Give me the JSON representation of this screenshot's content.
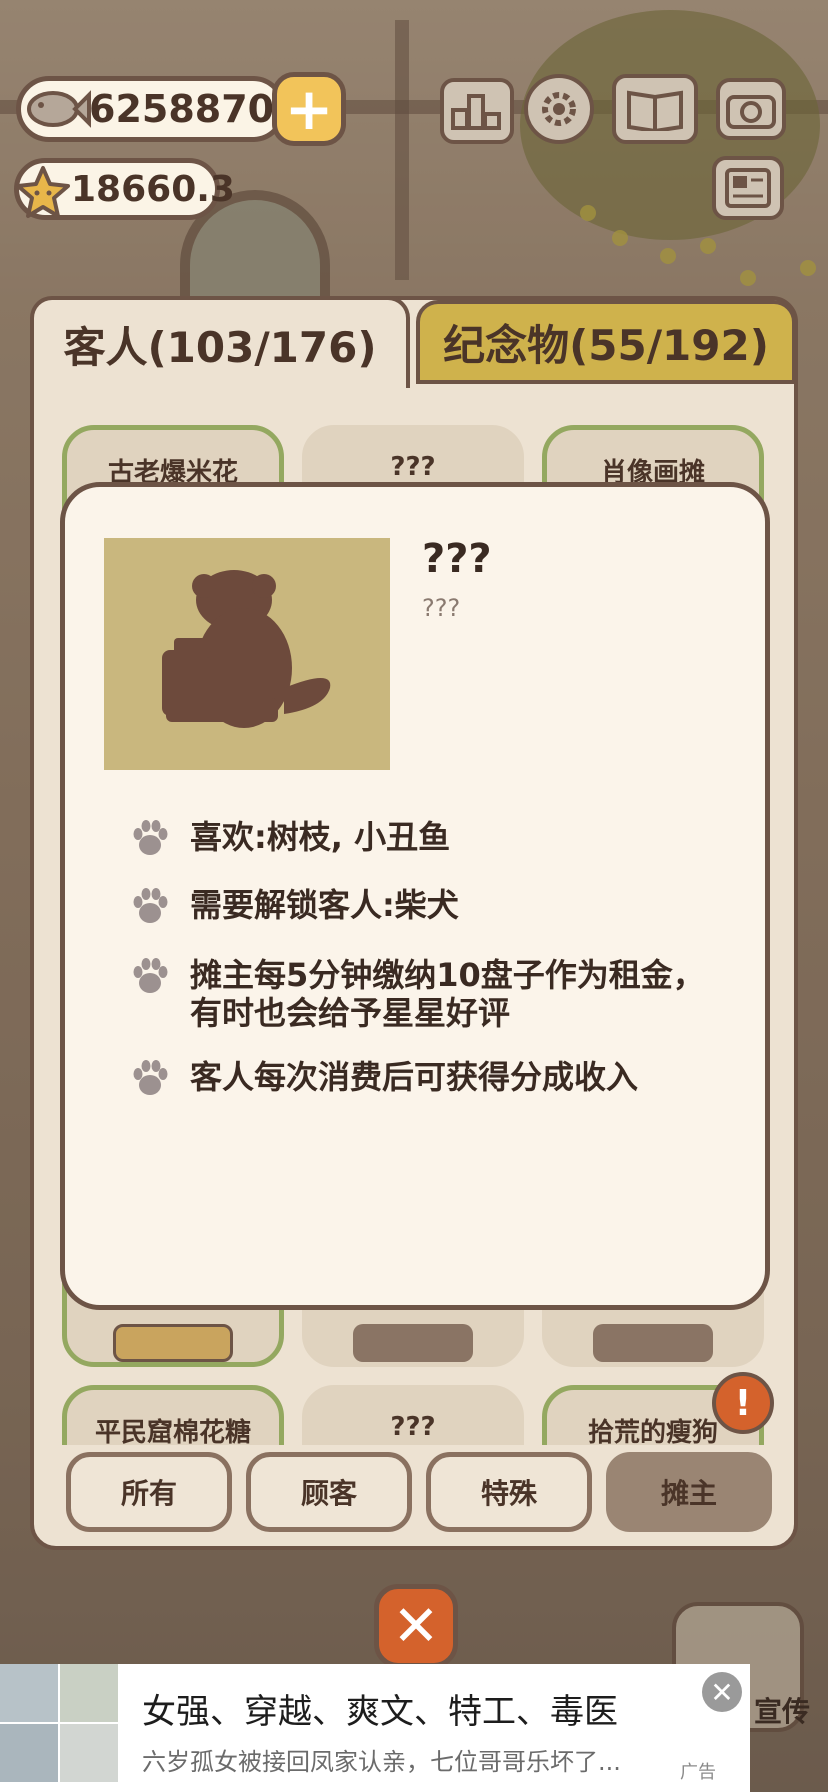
{
  "hud": {
    "fish_count": "6258870",
    "star_count": "18660.3",
    "add_label": "+",
    "icons": [
      "ranking-icon",
      "settings-icon",
      "book-icon",
      "camera-icon",
      "newspaper-icon"
    ]
  },
  "tabs": {
    "customers": "客人(103/176)",
    "souvenirs": "纪念物(55/192)"
  },
  "grid": {
    "top_row": [
      "古老爆米花",
      "???",
      "肖像画摊"
    ],
    "bottom_row": [
      "平民窟棉花糖",
      "???",
      "拾荒的瘦狗"
    ]
  },
  "detail": {
    "name": "???",
    "subtitle": "???",
    "info": [
      "喜欢:树枝, 小丑鱼",
      "需要解锁客人:柴犬",
      "摊主每5分钟缴纳10盘子作为租金，",
      "有时也会给予星星好评",
      "客人每次消费后可获得分成收入"
    ]
  },
  "filters": {
    "all": "所有",
    "customer": "顾客",
    "special": "特殊",
    "vendor": "摊主",
    "active": "摊主"
  },
  "alert_label": "!",
  "close_label": "✕",
  "background": {
    "promo_label": "宣传"
  },
  "ad": {
    "title": "女强、穿越、爽文、特工、毒医",
    "description": "六岁孤女被接回凤家认亲，七位哥哥乐坏了...",
    "tag": "广告",
    "close": "✕"
  },
  "colors": {
    "panel": "#ede2d2",
    "border": "#6d5446",
    "tab_inactive": "#cfb24c",
    "unlocked_border": "#94a860",
    "accent": "#d4622c"
  }
}
